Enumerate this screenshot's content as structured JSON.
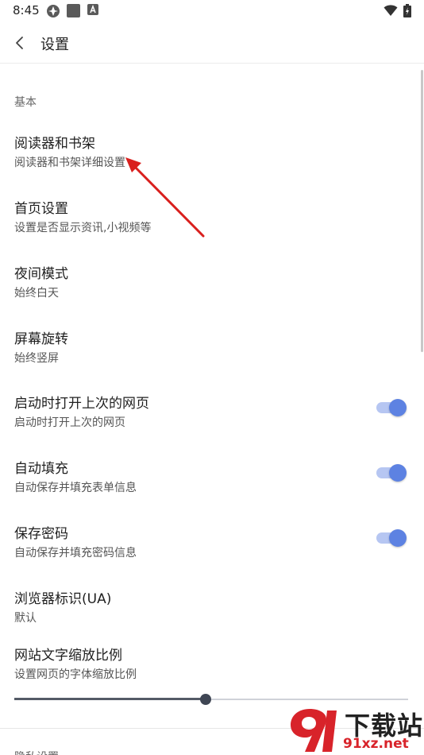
{
  "status_bar": {
    "time": "8:45"
  },
  "app_bar": {
    "title": "设置"
  },
  "sections": {
    "basic": {
      "header": "基本"
    },
    "next": {
      "header": "隐私设置"
    }
  },
  "items": [
    {
      "title": "阅读器和书架",
      "subtitle": "阅读器和书架详细设置"
    },
    {
      "title": "首页设置",
      "subtitle": "设置是否显示资讯,小视频等"
    },
    {
      "title": "夜间模式",
      "subtitle": "始终白天"
    },
    {
      "title": "屏幕旋转",
      "subtitle": "始终竖屏"
    },
    {
      "title": "启动时打开上次的网页",
      "subtitle": "启动时打开上次的网页",
      "toggle_on": true
    },
    {
      "title": "自动填充",
      "subtitle": "自动保存并填充表单信息",
      "toggle_on": true
    },
    {
      "title": "保存密码",
      "subtitle": "自动保存并填充密码信息",
      "toggle_on": true
    },
    {
      "title": "浏览器标识(UA)",
      "subtitle": "默认"
    },
    {
      "title": "网站文字缩放比例",
      "subtitle": "设置网页的字体缩放比例"
    }
  ],
  "font_scale_slider": {
    "fraction": 0.485
  },
  "watermark": {
    "top_text": "下载站",
    "bottom_text": "91xz.net"
  },
  "colors": {
    "accent": "#5d82e2",
    "accent_track": "#b6c6f2",
    "annotation_arrow": "#d9201e",
    "watermark_red": "#d8232a"
  },
  "icons": [
    "wifi-icon",
    "battery-icon",
    "back-arrow-icon"
  ]
}
